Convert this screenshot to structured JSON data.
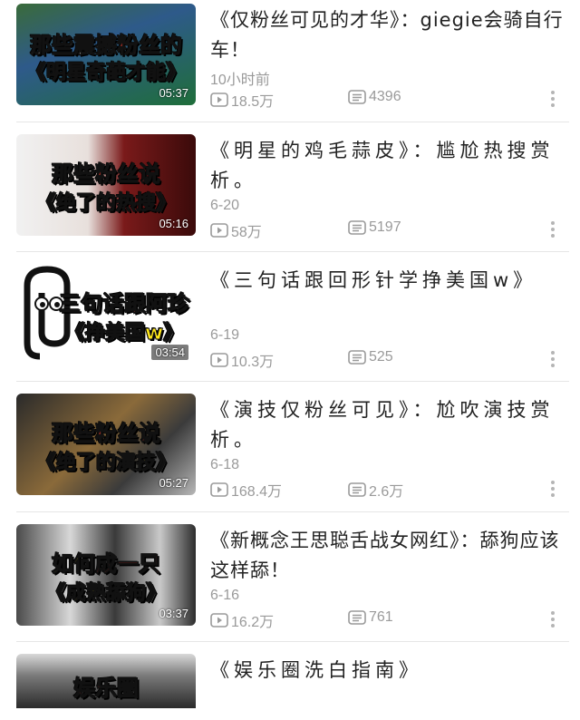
{
  "videos": [
    {
      "title": "《仅粉丝可见的才华》：giegie会骑自行车！",
      "date": "10小时前",
      "plays": "18.5万",
      "danmaku": "4396",
      "caption_line1_a": "那些震撼",
      "caption_line1_b": "粉丝的",
      "caption_line2": "《明星奇葩才能》",
      "duration": "05:37"
    },
    {
      "title": "《明星的鸡毛蒜皮》：尴尬热搜赏析。",
      "date": "6-20",
      "plays": "58万",
      "danmaku": "5197",
      "caption_line1_a": "那些",
      "caption_line1_b": "粉丝说",
      "caption_line2": "《绝了的热搜》",
      "duration": "05:16"
    },
    {
      "title": "《三句话跟回形针学挣美国w》",
      "date": "6-19",
      "plays": "10.3万",
      "danmaku": "525",
      "caption_line1_a": "三句话",
      "caption_line1_b": "跟阿珍",
      "caption_line2": "《挣美国w》",
      "duration": "03:54"
    },
    {
      "title": "《演技仅粉丝可见》：尬吹演技赏析。",
      "date": "6-18",
      "plays": "168.4万",
      "danmaku": "2.6万",
      "caption_line1_a": "那些",
      "caption_line1_b": "粉丝说",
      "caption_line2": "《绝了的演技》",
      "duration": "05:27"
    },
    {
      "title": "《新概念王思聪舌战女网红》：舔狗应该这样舔！",
      "date": "6-16",
      "plays": "16.2万",
      "danmaku": "761",
      "caption_line1_a": "如何",
      "caption_line1_b": "成一只",
      "caption_line2": "《成熟舔狗》",
      "duration": "03:37"
    },
    {
      "title": "《娱乐圈洗白指南》",
      "caption_line1_a": "",
      "caption_line1_b": "娱乐圈"
    }
  ],
  "icons": {
    "play_count": "play-count-icon",
    "danmaku_count": "danmaku-icon",
    "more": "more-vertical-icon"
  },
  "colors": {
    "caption_red": "#ff3d2e",
    "caption_yellow": "#ffe81a",
    "meta_gray": "#9a9a9a"
  }
}
